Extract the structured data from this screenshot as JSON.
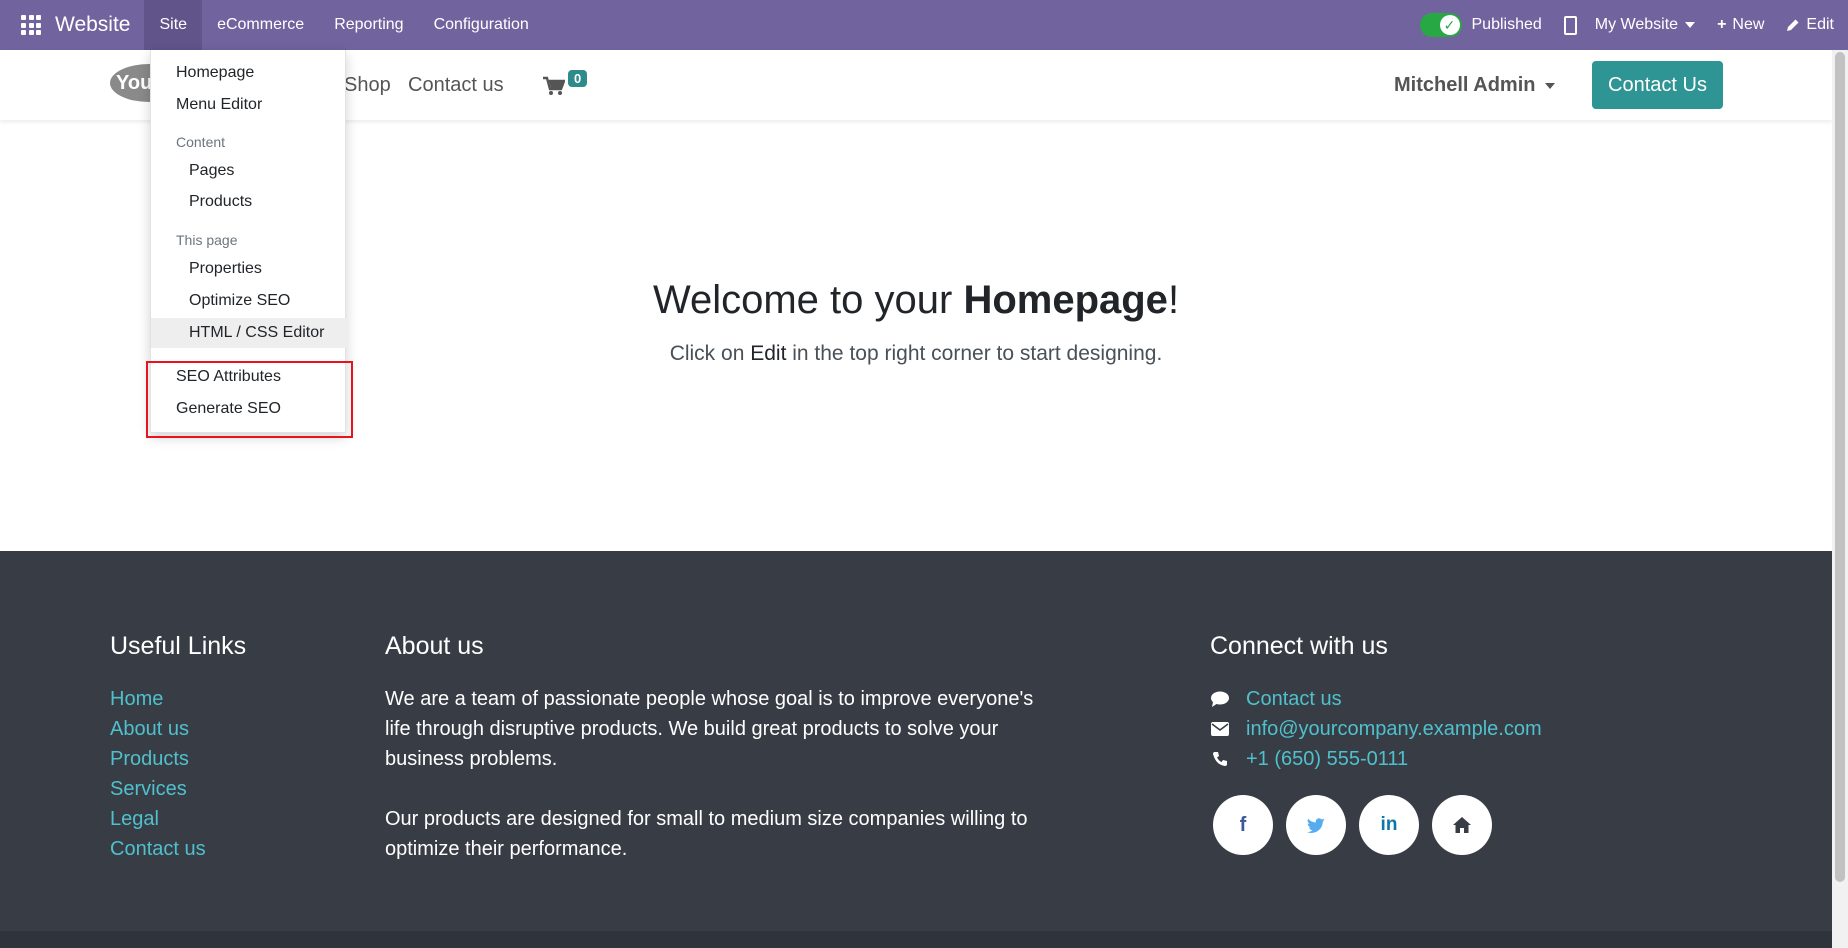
{
  "topbar": {
    "brand": "Website",
    "menu": [
      "Site",
      "eCommerce",
      "Reporting",
      "Configuration"
    ],
    "published_label": "Published",
    "website_selector": "My Website",
    "new_label": "New",
    "edit_label": "Edit",
    "accent_color": "#71639e"
  },
  "header": {
    "logo_text": "You",
    "nav": {
      "shop": "Shop",
      "contact": "Contact us"
    },
    "cart_count": "0",
    "user": "Mitchell Admin",
    "contact_button": "Contact Us"
  },
  "dropdown": {
    "homepage": "Homepage",
    "menu_editor": "Menu Editor",
    "content_header": "Content",
    "pages": "Pages",
    "products": "Products",
    "this_page_header": "This page",
    "properties": "Properties",
    "optimize_seo": "Optimize SEO",
    "html_css_editor": "HTML / CSS Editor",
    "seo_attributes": "SEO Attributes",
    "generate_seo": "Generate SEO"
  },
  "hero": {
    "title_prefix": "Welcome to your ",
    "title_bold": "Homepage",
    "title_suffix": "!",
    "sub_prefix": "Click on ",
    "sub_edit": "Edit",
    "sub_suffix": " in the top right corner to start designing."
  },
  "footer": {
    "useful_links_title": "Useful Links",
    "links": [
      "Home",
      "About us",
      "Products",
      "Services",
      "Legal",
      "Contact us"
    ],
    "about_title": "About us",
    "about_p1": "We are a team of passionate people whose goal is to improve everyone's life through disruptive products. We build great products to solve your business problems.",
    "about_p2": "Our products are designed for small to medium size companies willing to optimize their performance.",
    "connect_title": "Connect with us",
    "connect_contact": "Contact us",
    "connect_email": "info@yourcompany.example.com",
    "connect_phone": "+1 (650) 555-0111",
    "social": [
      "facebook-icon",
      "twitter-icon",
      "linkedin-icon",
      "home-icon"
    ]
  }
}
